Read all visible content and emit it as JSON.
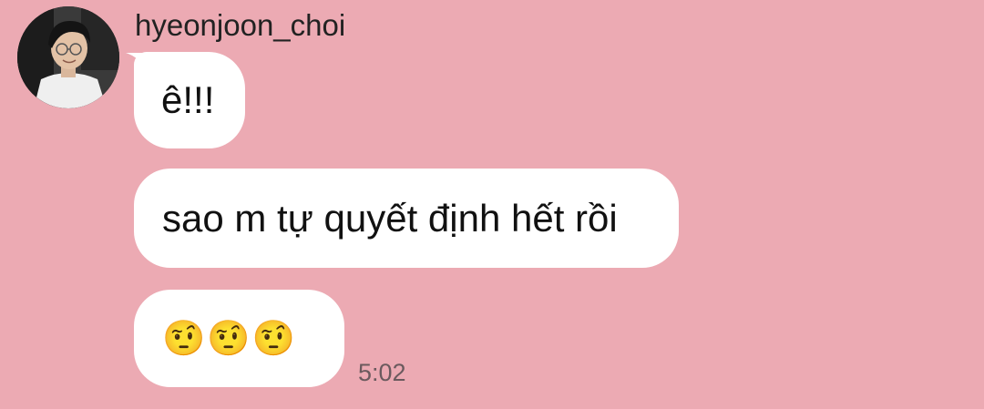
{
  "chat": {
    "sender_name": "hyeonjoon_choi",
    "avatar_icon": "profile-photo",
    "messages": [
      {
        "text": "ê!!!"
      },
      {
        "text": "sao m tự quyết định hết rồi"
      },
      {
        "text": "🤨🤨🤨"
      }
    ],
    "timestamp": "5:02"
  },
  "colors": {
    "background": "#ecaab3",
    "bubble": "#ffffff",
    "text": "#111111",
    "timestamp": "#6b5a5e"
  }
}
